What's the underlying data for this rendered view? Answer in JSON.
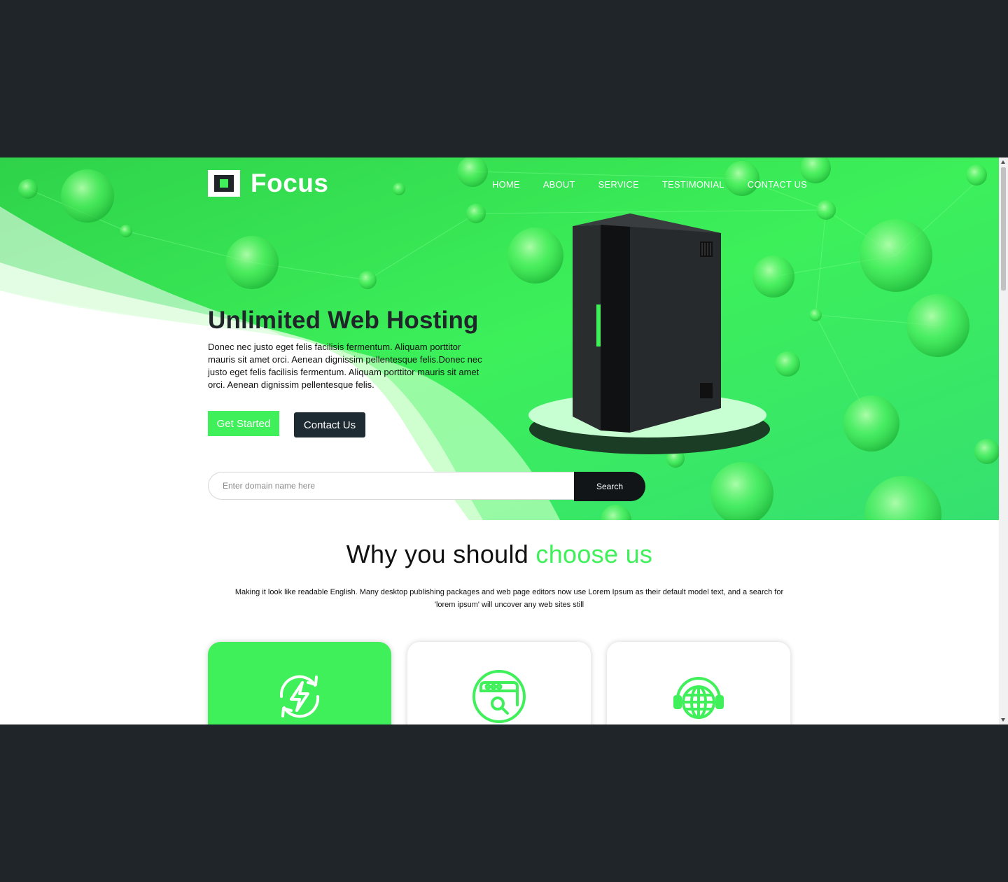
{
  "brand": {
    "name": "Focus"
  },
  "nav": {
    "items": [
      {
        "label": "HOME"
      },
      {
        "label": "ABOUT"
      },
      {
        "label": "SERVICE"
      },
      {
        "label": "TESTIMONIAL"
      },
      {
        "label": "CONTACT US"
      }
    ]
  },
  "hero": {
    "title": "Unlimited Web Hosting",
    "text": "Donec nec justo eget felis facilisis fermentum. Aliquam porttitor mauris sit amet orci. Aenean dignissim pellentesque felis.Donec nec justo eget felis facilisis fermentum. Aliquam porttitor mauris sit amet orci. Aenean dignissim pellentesque felis.",
    "get_started_label": "Get Started",
    "contact_label": "Contact Us"
  },
  "search": {
    "placeholder": "Enter domain name here",
    "button_label": "Search"
  },
  "why": {
    "title_main": "Why you should ",
    "title_accent": "choose us",
    "text": "Making it look like readable English. Many desktop publishing packages and web page editors now use Lorem Ipsum as their default model text, and a search for 'lorem ipsum' will uncover any web sites still"
  },
  "cards": [
    {
      "icon": "refresh-lightning-icon"
    },
    {
      "icon": "browser-search-icon"
    },
    {
      "icon": "globe-headset-icon"
    }
  ],
  "colors": {
    "accent": "#40f05a",
    "dark": "#1f2528",
    "frame": "#1f2528"
  }
}
